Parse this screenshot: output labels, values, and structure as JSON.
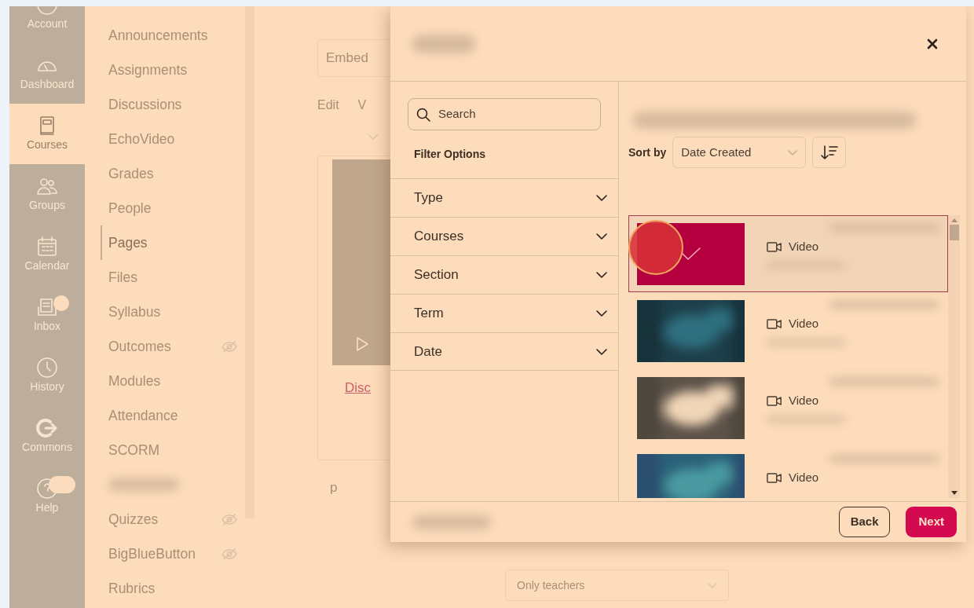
{
  "global_nav": [
    {
      "label": "Account",
      "selected": false,
      "badge": false
    },
    {
      "label": "Dashboard",
      "selected": false,
      "badge": false
    },
    {
      "label": "Courses",
      "selected": true,
      "badge": false
    },
    {
      "label": "Groups",
      "selected": false,
      "badge": false
    },
    {
      "label": "Calendar",
      "selected": false,
      "badge": false
    },
    {
      "label": "Inbox",
      "selected": false,
      "badge": true
    },
    {
      "label": "History",
      "selected": false,
      "badge": false
    },
    {
      "label": "Commons",
      "selected": false,
      "badge": false
    },
    {
      "label": "Help",
      "selected": false,
      "badge": true
    }
  ],
  "course_nav": [
    {
      "label": "Announcements",
      "selected": false,
      "hidden": false
    },
    {
      "label": "Assignments",
      "selected": false,
      "hidden": false
    },
    {
      "label": "Discussions",
      "selected": false,
      "hidden": false
    },
    {
      "label": "EchoVideo",
      "selected": false,
      "hidden": false
    },
    {
      "label": "Grades",
      "selected": false,
      "hidden": false
    },
    {
      "label": "People",
      "selected": false,
      "hidden": false
    },
    {
      "label": "Pages",
      "selected": true,
      "hidden": false
    },
    {
      "label": "Files",
      "selected": false,
      "hidden": false
    },
    {
      "label": "Syllabus",
      "selected": false,
      "hidden": false
    },
    {
      "label": "Outcomes",
      "selected": false,
      "hidden": true
    },
    {
      "label": "Modules",
      "selected": false,
      "hidden": false
    },
    {
      "label": "Attendance",
      "selected": false,
      "hidden": false
    },
    {
      "label": "SCORM",
      "selected": false,
      "hidden": false
    },
    {
      "kind": "redacted"
    },
    {
      "label": "Quizzes",
      "selected": false,
      "hidden": true
    },
    {
      "label": "BigBlueButton",
      "selected": false,
      "hidden": true
    },
    {
      "label": "Rubrics",
      "selected": false,
      "hidden": false
    }
  ],
  "page": {
    "embed_field": "Embed",
    "tabs": [
      "Edit",
      "V"
    ],
    "link": "Disc",
    "paragraph": "p",
    "visibility_select": "Only teachers"
  },
  "modal": {
    "search": {
      "placeholder": "Search"
    },
    "filter_title": "Filter Options",
    "filters": [
      {
        "label": "Type",
        "expanded": false
      },
      {
        "label": "Courses",
        "expanded": false
      },
      {
        "label": "Section",
        "expanded": false
      },
      {
        "label": "Term",
        "expanded": false
      },
      {
        "label": "Date",
        "expanded": false
      }
    ],
    "sort": {
      "label": "Sort by",
      "value": "Date Created"
    },
    "items": [
      {
        "type": "Video",
        "selected": true
      },
      {
        "type": "Video",
        "selected": false
      },
      {
        "type": "Video",
        "selected": false
      },
      {
        "type": "Video",
        "selected": false
      }
    ],
    "buttons": [
      {
        "label": "Back",
        "kind": "secondary"
      },
      {
        "label": "Next",
        "kind": "primary"
      }
    ]
  }
}
